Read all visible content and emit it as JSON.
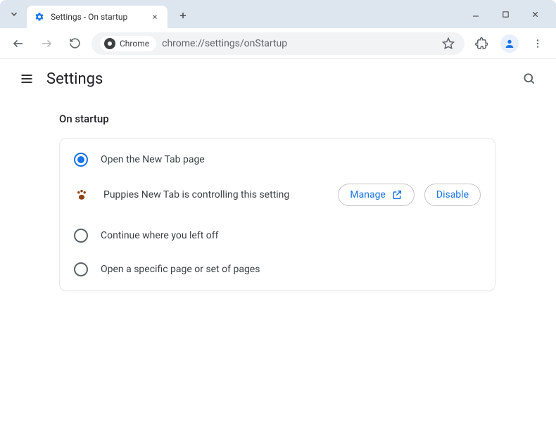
{
  "titlebar": {
    "tab_title": "Settings - On startup"
  },
  "address": {
    "chip_label": "Chrome",
    "url": "chrome://settings/onStartup"
  },
  "page": {
    "title": "Settings"
  },
  "section": {
    "heading": "On startup",
    "options": [
      {
        "label": "Open the New Tab page",
        "selected": true
      },
      {
        "label": "Continue where you left off",
        "selected": false
      },
      {
        "label": "Open a specific page or set of pages",
        "selected": false
      }
    ],
    "extension_notice": {
      "text": "Puppies New Tab is controlling this setting",
      "manage_label": "Manage",
      "disable_label": "Disable"
    }
  }
}
